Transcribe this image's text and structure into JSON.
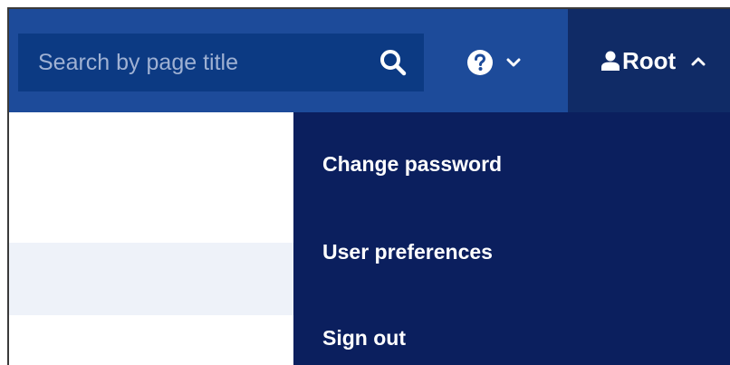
{
  "header": {
    "search": {
      "placeholder": "Search by page title",
      "icon": "search-icon"
    },
    "help": {
      "icon": "help-icon",
      "chevron": "chevron-down-icon"
    },
    "user_menu": {
      "username": "Root",
      "icon": "user-icon",
      "chevron": "chevron-up-icon",
      "expanded": true
    }
  },
  "dropdown": {
    "items": [
      {
        "label": "Change password"
      },
      {
        "label": "User preferences"
      },
      {
        "label": "Sign out"
      }
    ]
  },
  "colors": {
    "header_bg": "#1d4b9a",
    "search_bg": "#0c3a83",
    "user_menu_bg": "#102b66",
    "dropdown_bg": "#0b1f5e",
    "row_highlight": "#eef2f9"
  }
}
